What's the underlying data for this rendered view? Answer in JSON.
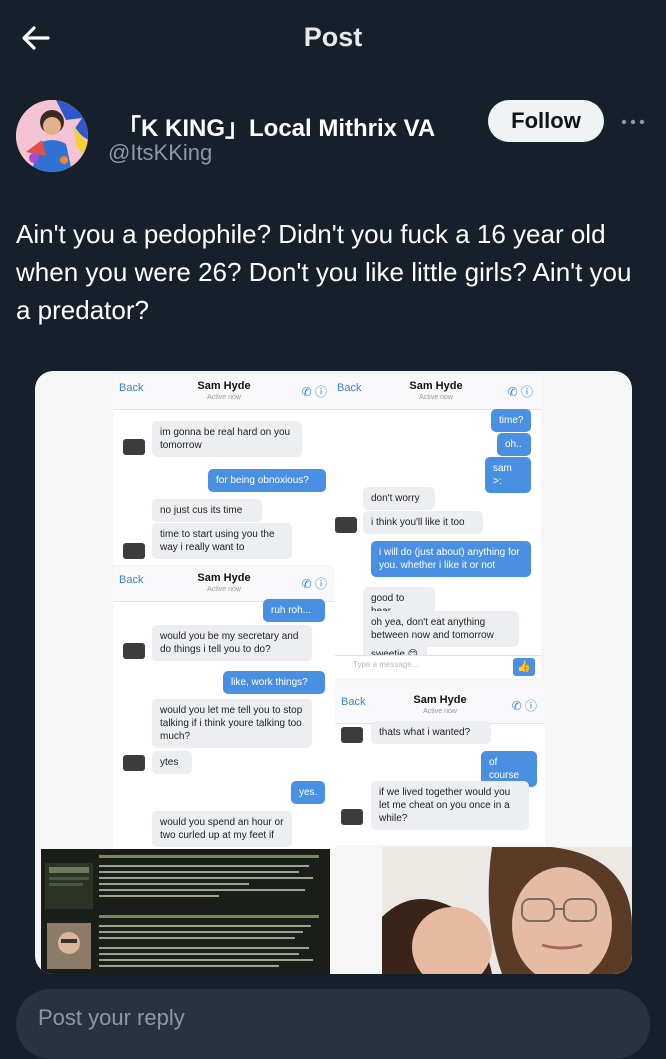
{
  "header": {
    "title": "Post"
  },
  "author": {
    "display_name": "「K KING」Local Mithrix VA",
    "handle": "@ItsKKing",
    "follow_label": "Follow"
  },
  "post": {
    "text": "Ain't you a pedophile? Didn't you fuck a 16 year old when you were 26? Don't you like little girls? Ain't you a predator?"
  },
  "media": {
    "chat1": {
      "back": "Back",
      "name": "Sam Hyde",
      "status": "Active now",
      "m1": "im gonna be real hard on you tomorrow",
      "m2": "for being obnoxious?",
      "m3": "no just cus its time",
      "m4": "time to start using you the way i really want to"
    },
    "chat2": {
      "back": "Back",
      "name": "Sam Hyde",
      "status": "Active now",
      "m1": "time?",
      "m2": "oh..",
      "m3": "sam >:",
      "m4": "don't worry",
      "m5": "i think you'll like it too",
      "m6": "i will do (just about) anything for you. whether i like it or not",
      "m7": "good to hear",
      "m8": "oh yea, don't eat anything between now and tomorrow",
      "m9": "sweetie 😊",
      "input_placeholder": "Type a message..."
    },
    "chat3": {
      "back": "Back",
      "name": "Sam Hyde",
      "status": "Active now",
      "m1": "ruh roh...",
      "m2": "would you be my secretary and do things i tell you to do?",
      "m3": "like, work things?",
      "m4": "would you let me tell you to stop talking if i think youre talking too much?",
      "m5": "ytes",
      "m6": "yes.",
      "m7": "would you spend an hour or two curled up at my feet if"
    },
    "chat4": {
      "back": "Back",
      "name": "Sam Hyde",
      "status": "Active now",
      "m1": "thats what i wanted?",
      "m2": "of course",
      "m3": "if we lived together would you let me cheat on you once in a while?"
    }
  },
  "reply": {
    "placeholder": "Post your reply"
  },
  "colors": {
    "background": "#15202b",
    "accent": "#4a90e2",
    "muted": "#8b98a5"
  },
  "icons": [
    "back-arrow-icon",
    "more-icon",
    "phone-icon",
    "info-icon",
    "like-icon"
  ]
}
